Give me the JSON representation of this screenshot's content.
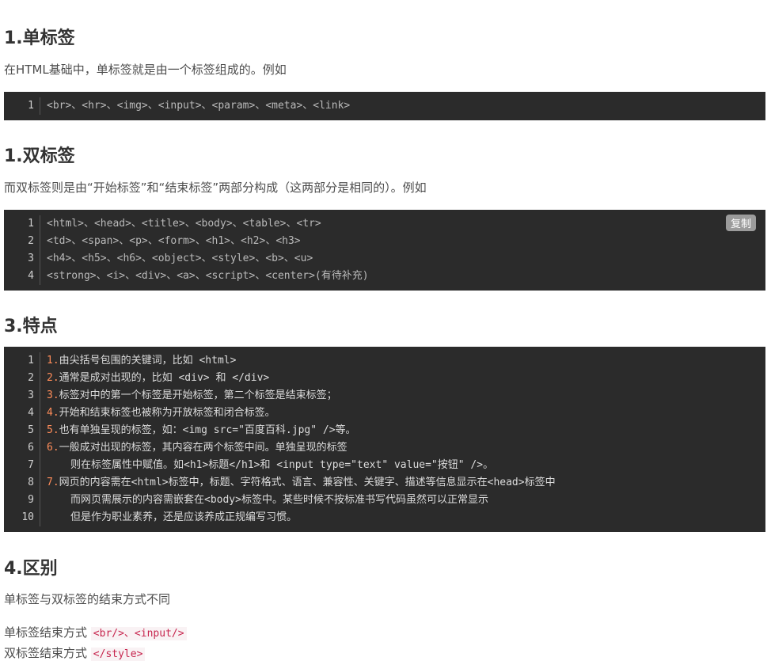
{
  "sections": {
    "s1": {
      "title": "1.单标签",
      "desc": "在HTML基础中，单标签就是由一个标签组成的。例如",
      "lines": [
        "<br>、<hr>、<img>、<input>、<param>、<meta>、<link>"
      ]
    },
    "s2": {
      "title": "1.双标签",
      "desc": "而双标签则是由“开始标签”和“结束标签”两部分构成（这两部分是相同的）。例如",
      "copy_label": "复制",
      "lines": [
        "<html>、<head>、<title>、<body>、<table>、<tr>",
        "<td>、<span>、<p>、<form>、<h1>、<h2>、<h3>",
        "<h4>、<h5>、<h6>、<object>、<style>、<b>、<u>",
        "<strong>、<i>、<div>、<a>、<script>、<center>(有待补充)"
      ]
    },
    "s3": {
      "title": "3.特点",
      "lines": [
        {
          "num": "1.",
          "text": "由尖括号包围的关键词，比如 <html>"
        },
        {
          "num": "2.",
          "text": "通常是成对出现的，比如 <div> 和 </div>"
        },
        {
          "num": "3.",
          "text": "标签对中的第一个标签是开始标签，第二个标签是结束标签；"
        },
        {
          "num": "4.",
          "text": "开始和结束标签也被称为开放标签和闭合标签。"
        },
        {
          "num": "5.",
          "text": "也有单独呈现的标签，如：<img src=\"百度百科.jpg\" />等。"
        },
        {
          "num": "6.",
          "text": "一般成对出现的标签，其内容在两个标签中间。单独呈现的标签"
        },
        {
          "num": "",
          "text": "则在标签属性中赋值。如<h1>标题</h1>和 <input type=\"text\" value=\"按钮\" />。"
        },
        {
          "num": "7.",
          "text": "网页的内容需在<html>标签中，标题、字符格式、语言、兼容性、关键字、描述等信息显示在<head>标签中"
        },
        {
          "num": "",
          "text": "而网页需展示的内容需嵌套在<body>标签中。某些时候不按标准书写代码虽然可以正常显示"
        },
        {
          "num": "",
          "text": "但是作为职业素养，还是应该养成正规编写习惯。"
        }
      ]
    },
    "s4": {
      "title": "4.区别",
      "desc": "单标签与双标签的结束方式不同",
      "single_label": "单标签结束方式",
      "single_code": "<br/>、<input/>",
      "double_label": "双标签结束方式",
      "double_code": "</style>"
    }
  }
}
